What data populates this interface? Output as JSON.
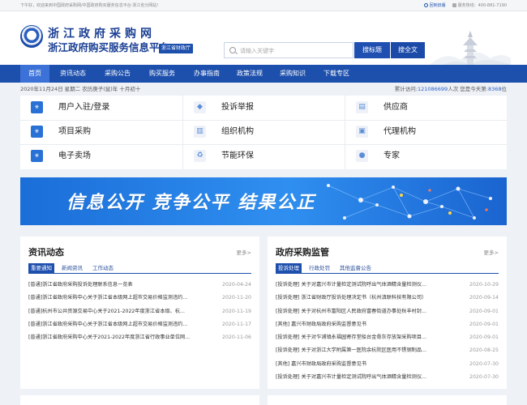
{
  "topbar": {
    "welcome": "下午好，欢迎来到中国政府采购网/中国政府购买服务信息平台·浙江省分网站！",
    "old_site": "回到旧版",
    "hotline": "服务热线：400-881-7190"
  },
  "header": {
    "title_line1": "浙江政府采购网",
    "title_line2": "浙江政府购买服务信息平台",
    "badge": "浙江省财政厅",
    "search_placeholder": "请输入关键字",
    "search_title_btn": "搜标题",
    "search_full_btn": "搜全文"
  },
  "nav": {
    "items": [
      {
        "label": "首页"
      },
      {
        "label": "资讯动态"
      },
      {
        "label": "采购公告"
      },
      {
        "label": "购买服务"
      },
      {
        "label": "办事指南"
      },
      {
        "label": "政策法规"
      },
      {
        "label": "采购知识"
      },
      {
        "label": "下载专区"
      }
    ]
  },
  "info": {
    "date": "2020年11月24日 星期二 农历庚子(鼠)年 十月初十",
    "total_prefix": "累计访问:",
    "total_count": "121086699",
    "total_unit": "人次",
    "today_prefix": "  您是今天第:",
    "today_count": "8368",
    "today_unit": "位"
  },
  "quick": {
    "items": [
      {
        "label": "用户入驻/登录",
        "icon": "link-icon"
      },
      {
        "label": "投诉举报",
        "icon": "report-icon"
      },
      {
        "label": "供应商",
        "icon": "supplier-icon"
      },
      {
        "label": "项目采购",
        "icon": "project-icon"
      },
      {
        "label": "组织机构",
        "icon": "org-icon"
      },
      {
        "label": "代理机构",
        "icon": "agency-icon"
      },
      {
        "label": "电子卖场",
        "icon": "mall-icon"
      },
      {
        "label": "节能环保",
        "icon": "recycle-icon"
      },
      {
        "label": "专家",
        "icon": "expert-icon"
      }
    ]
  },
  "banner": {
    "text": "信息公开  竞争公平  结果公正"
  },
  "news": {
    "title": "资讯动态",
    "more": "更多>",
    "tabs": [
      {
        "label": "重要通知"
      },
      {
        "label": "新闻资讯"
      },
      {
        "label": "工作动态"
      }
    ],
    "rows": [
      {
        "title": "[普通]浙江省政府采购投诉处理联系信息一览表",
        "date": "2020-04-24"
      },
      {
        "title": "[普通]浙江省政府采购中心关于浙江省本级网上超市交易价格监测违约...",
        "date": "2020-11-20"
      },
      {
        "title": "[普通]杭州市公共资源交易中心关于2021-2022年度浙江省本级、杭...",
        "date": "2020-11-19"
      },
      {
        "title": "[普通]浙江省政府采购中心关于浙江省本级网上超市交易价格监测违约...",
        "date": "2020-11-17"
      },
      {
        "title": "[普通]浙江省政府采购中心关于2021-2022年度浙江省行政事业单位网...",
        "date": "2020-11-06"
      }
    ]
  },
  "supervision": {
    "title": "政府采购监管",
    "more": "更多>",
    "tabs": [
      {
        "label": "投诉处理"
      },
      {
        "label": "行政处罚"
      },
      {
        "label": "其他监督公告"
      }
    ],
    "rows": [
      {
        "title": "[投诉处理] 关于对嘉兴市计量检定测试院呼出气体酒精含量检测仪...",
        "date": "2020-10-29"
      },
      {
        "title": "[投诉处理] 浙江省财政厅投诉处理决定书（杭州滇联科技有限公司）",
        "date": "2020-09-14"
      },
      {
        "title": "[投诉处理] 关于对杭州市富阳区人民政府富春街道办事处秋丰村封...",
        "date": "2020-09-01"
      },
      {
        "title": "[其他] 嘉兴市财政局政府采购监督意见书",
        "date": "2020-09-01"
      },
      {
        "title": "[投诉处理] 关于对乍浦镇永福园寄存堂船台金骨灰存放架采购项目...",
        "date": "2020-09-01"
      },
      {
        "title": "[投诉处理] 关于对浙江大学附属第一医院余杭院区医用不锈钢制品...",
        "date": "2020-08-25"
      },
      {
        "title": "[其他] 嘉兴市财政局政府采购监督意见书",
        "date": "2020-07-30"
      },
      {
        "title": "[投诉处理] 关于对嘉兴市计量检定测试院呼出气体酒精含量检测仪...",
        "date": "2020-07-30"
      }
    ]
  }
}
